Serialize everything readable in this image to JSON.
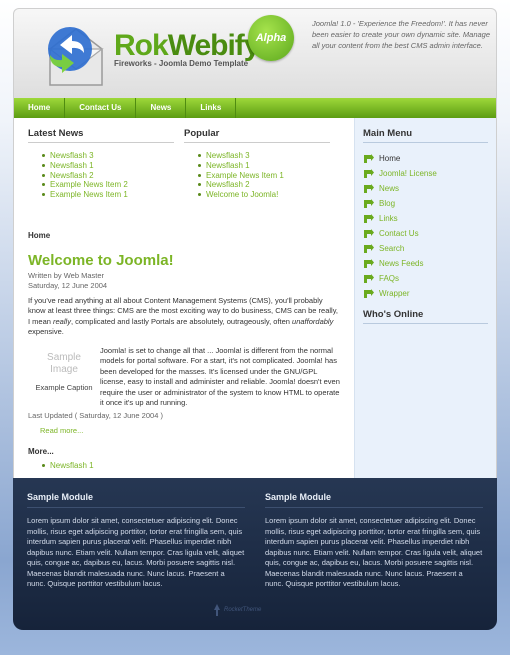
{
  "header": {
    "logo_rok": "Rok",
    "logo_webify": "Webify",
    "badge": "Alpha",
    "subtitle": "Fireworks - Joomla Demo Template",
    "blurb": "Joomla! 1.0 - 'Experience the Freedom!'. It has never been easier to create your own dynamic site. Manage all your content from the best CMS admin interface."
  },
  "nav": [
    "Home",
    "Contact Us",
    "News",
    "Links"
  ],
  "latest_news": {
    "title": "Latest News",
    "items": [
      "Newsflash 3",
      "Newsflash 1",
      "Newsflash 2",
      "Example News Item 2",
      "Example News Item 1"
    ]
  },
  "popular": {
    "title": "Popular",
    "items": [
      "Newsflash 3",
      "Newsflash 1",
      "Example News Item 1",
      "Newsflash 2",
      "Welcome to Joomla!"
    ]
  },
  "pathway": "Home",
  "article": {
    "title": "Welcome to Joomla!",
    "author": "Written by Web Master",
    "date": "Saturday, 12 June 2004",
    "intro_a": "If you've read anything at all about Content Management Systems (CMS), you'll probably know at least three things: CMS are the most exciting way to do business, CMS can be really, I mean ",
    "intro_em1": "really",
    "intro_b": ", complicated and lastly Portals are absolutely, outrageously, often ",
    "intro_em2": "unaffordably",
    "intro_c": " expensive.",
    "image_placeholder_1": "Sample",
    "image_placeholder_2": "Image",
    "caption": "Example Caption",
    "body": "Joomla! is set to change all that ... Joomla! is different from the normal models for portal software. For a start, it's not complicated. Joomla! has been developed for the masses. It's licensed under the GNU/GPL license, easy to install and administer and reliable. Joomla! doesn't even require the user or administrator of the system to know HTML to operate it once it's up and running.",
    "updated": "Last Updated ( Saturday, 12 June 2004 )",
    "readmore": "Read more..."
  },
  "more": {
    "title": "More...",
    "items": [
      "Newsflash 1"
    ]
  },
  "main_menu": {
    "title": "Main Menu",
    "items": [
      "Home",
      "Joomla! License",
      "News",
      "Blog",
      "Links",
      "Contact Us",
      "Search",
      "News Feeds",
      "FAQs",
      "Wrapper"
    ]
  },
  "whos_online": {
    "title": "Who's Online"
  },
  "footer": {
    "modules": [
      {
        "title": "Sample Module",
        "text": "Lorem ipsum dolor sit amet, consectetuer adipiscing elit. Donec mollis, risus eget adipiscing porttitor, tortor erat fringilla sem, quis interdum sapien purus placerat velit. Phasellus imperdiet nibh dapibus nunc. Etiam velit. Nullam tempor. Cras ligula velit, aliquet quis, congue ac, dapibus eu, lacus. Morbi posuere sagittis nisl. Maecenas blandit malesuada nunc. Nunc lacus. Praesent a nunc. Quisque porttitor vestibulum lacus."
      },
      {
        "title": "Sample Module",
        "text": "Lorem ipsum dolor sit amet, consectetuer adipiscing elit. Donec mollis, risus eget adipiscing porttitor, tortor erat fringilla sem, quis interdum sapien purus placerat velit. Phasellus imperdiet nibh dapibus nunc. Etiam velit. Nullam tempor. Cras ligula velit, aliquet quis, congue ac, dapibus eu, lacus. Morbi posuere sagittis nisl. Maecenas blandit malesuada nunc. Nunc lacus. Praesent a nunc. Quisque porttitor vestibulum lacus."
      }
    ],
    "credit": "RocketTheme"
  },
  "colors": {
    "accent_green": "#7cb526",
    "nav_green": "#5b9c12",
    "footer_navy": "#1c2a44",
    "sidebar_bg": "#e9f1fb"
  }
}
